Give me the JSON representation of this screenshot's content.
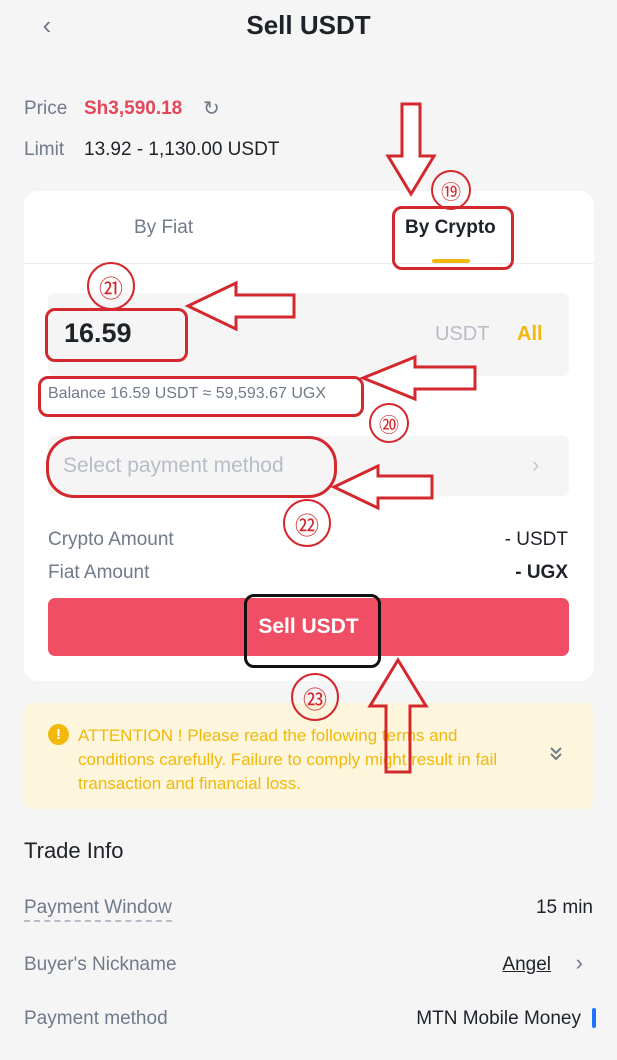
{
  "header": {
    "back_icon": "chevron-left-icon",
    "title": "Sell USDT"
  },
  "price": {
    "label": "Price",
    "value": "Sh3,590.18",
    "refresh_icon": "refresh-icon"
  },
  "limit": {
    "label": "Limit",
    "value": "13.92 - 1,130.00 USDT"
  },
  "tabs": {
    "by_fiat": "By Fiat",
    "by_crypto": "By Crypto",
    "active": "by_crypto"
  },
  "amount": {
    "value": "16.59",
    "unit": "USDT",
    "all": "All"
  },
  "balance": "Balance 16.59 USDT ≈ 59,593.67 UGX",
  "payment": {
    "placeholder": "Select payment method",
    "chevron": "›"
  },
  "summary": {
    "crypto_label": "Crypto Amount",
    "crypto_value": "- USDT",
    "fiat_label": "Fiat Amount",
    "fiat_value": "- UGX"
  },
  "sell_button": "Sell USDT",
  "attention": {
    "icon": "!",
    "text": "ATTENTION ! Please read the following terms and conditions carefully. Failure to comply might result in fail transaction and financial loss.",
    "expand_icon": "double-chevron-down-icon"
  },
  "trade_info": {
    "title": "Trade Info",
    "payment_window_label": "Payment Window",
    "payment_window_value": "15 min",
    "buyer_label": "Buyer's Nickname",
    "buyer_value": "Angel",
    "buyer_chevron": "›",
    "method_label": "Payment method",
    "method_value": "MTN Mobile Money"
  },
  "annotations": {
    "n19": "⑲",
    "n20": "⑳",
    "n21": "㉑",
    "n22": "㉒",
    "n23": "㉓"
  },
  "colors": {
    "sell": "#ef4e64",
    "accent": "#f0b90b",
    "price": "#e3475a",
    "annotation": "#d2282e"
  }
}
